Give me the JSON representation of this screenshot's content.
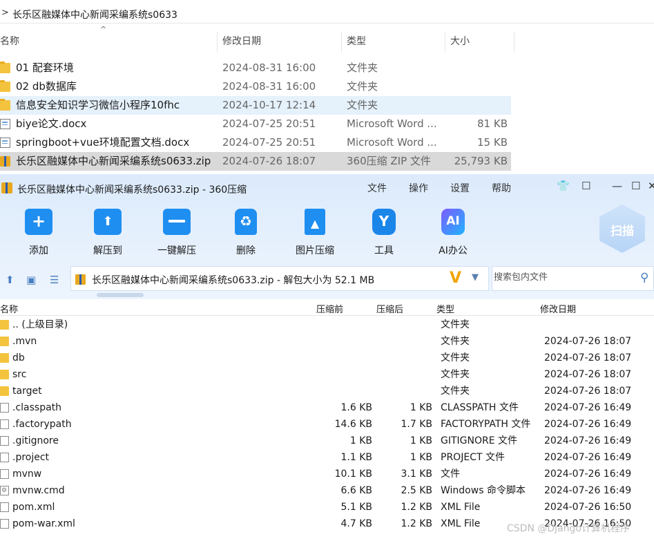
{
  "explorer": {
    "path_chevron": ">",
    "path": "长乐区融媒体中心新闻采编系统s0633",
    "columns": {
      "name": "名称",
      "date": "修改日期",
      "type": "类型",
      "size": "大小"
    },
    "rows": [
      {
        "name": "01 配套环境",
        "date": "2024-08-31 16:00",
        "type": "文件夹",
        "size": "",
        "icon": "folder-icon"
      },
      {
        "name": "02 db数据库",
        "date": "2024-08-31 16:00",
        "type": "文件夹",
        "size": "",
        "icon": "folder-icon"
      },
      {
        "name": "信息安全知识学习微信小程序10fhc",
        "date": "2024-10-17 12:14",
        "type": "文件夹",
        "size": "",
        "icon": "folder-icon"
      },
      {
        "name": "biye论文.docx",
        "date": "2024-07-25 20:51",
        "type": "Microsoft Word ...",
        "size": "81 KB",
        "icon": "word-doc-icon"
      },
      {
        "name": "springboot+vue环境配置文档.docx",
        "date": "2024-07-25 20:51",
        "type": "Microsoft Word ...",
        "size": "15 KB",
        "icon": "word-doc-icon"
      },
      {
        "name": "长乐区融媒体中心新闻采编系统s0633.zip",
        "date": "2024-07-26 18:07",
        "type": "360压缩 ZIP 文件",
        "size": "25,793 KB",
        "icon": "zip-icon"
      }
    ]
  },
  "zip_app": {
    "title": "长乐区融媒体中心新闻采编系统s0633.zip - 360压缩",
    "menu": [
      "文件",
      "操作",
      "设置",
      "帮助"
    ],
    "window_controls": {
      "shirt": "👕",
      "feedback": "☐",
      "minimize": "—",
      "maximize": "☐",
      "close": "✕"
    },
    "toolbar": [
      {
        "label": "添加",
        "icon": "add-icon"
      },
      {
        "label": "解压到",
        "icon": "extract-to-icon"
      },
      {
        "label": "一键解压",
        "icon": "one-click-extract-icon"
      },
      {
        "label": "删除",
        "icon": "delete-icon"
      },
      {
        "label": "图片压缩",
        "icon": "image-compress-icon"
      },
      {
        "label": "工具",
        "icon": "tools-icon"
      },
      {
        "label": "AI办公",
        "icon": "ai-office-icon"
      }
    ],
    "scan_label": "扫描",
    "path_text": "长乐区融媒体中心新闻采编系统s0633.zip - 解包大小为 52.1 MB",
    "search_placeholder": "搜索包内文件",
    "columns": {
      "name": "名称",
      "packed": "压缩前",
      "compressed": "压缩后",
      "type": "类型",
      "date": "修改日期"
    },
    "rows": [
      {
        "name": ".. (上级目录)",
        "packed": "",
        "compressed": "",
        "type": "文件夹",
        "date": "",
        "icon": "folder-icon"
      },
      {
        "name": ".mvn",
        "packed": "",
        "compressed": "",
        "type": "文件夹",
        "date": "2024-07-26 18:07",
        "icon": "folder-icon"
      },
      {
        "name": "db",
        "packed": "",
        "compressed": "",
        "type": "文件夹",
        "date": "2024-07-26 18:07",
        "icon": "folder-icon"
      },
      {
        "name": "src",
        "packed": "",
        "compressed": "",
        "type": "文件夹",
        "date": "2024-07-26 18:07",
        "icon": "folder-icon"
      },
      {
        "name": "target",
        "packed": "",
        "compressed": "",
        "type": "文件夹",
        "date": "2024-07-26 18:07",
        "icon": "folder-icon"
      },
      {
        "name": ".classpath",
        "packed": "1.6 KB",
        "compressed": "1 KB",
        "type": "CLASSPATH 文件",
        "date": "2024-07-26 16:49",
        "icon": "file-icon"
      },
      {
        "name": ".factorypath",
        "packed": "14.6 KB",
        "compressed": "1.7 KB",
        "type": "FACTORYPATH 文件",
        "date": "2024-07-26 16:49",
        "icon": "file-icon"
      },
      {
        "name": ".gitignore",
        "packed": "1 KB",
        "compressed": "1 KB",
        "type": "GITIGNORE 文件",
        "date": "2024-07-26 16:49",
        "icon": "file-icon"
      },
      {
        "name": ".project",
        "packed": "1.1 KB",
        "compressed": "1 KB",
        "type": "PROJECT 文件",
        "date": "2024-07-26 16:49",
        "icon": "file-icon"
      },
      {
        "name": "mvnw",
        "packed": "10.1 KB",
        "compressed": "3.1 KB",
        "type": "文件",
        "date": "2024-07-26 16:49",
        "icon": "file-icon"
      },
      {
        "name": "mvnw.cmd",
        "packed": "6.6 KB",
        "compressed": "2.5 KB",
        "type": "Windows 命令脚本",
        "date": "2024-07-26 16:49",
        "icon": "cmd-script-icon"
      },
      {
        "name": "pom.xml",
        "packed": "5.1 KB",
        "compressed": "1.2 KB",
        "type": "XML File",
        "date": "2024-07-26 16:50",
        "icon": "file-icon"
      },
      {
        "name": "pom-war.xml",
        "packed": "4.7 KB",
        "compressed": "1.2 KB",
        "type": "XML File",
        "date": "2024-07-26 16:50",
        "icon": "file-icon"
      }
    ]
  },
  "watermark": "CSDN @Django计算机程序"
}
